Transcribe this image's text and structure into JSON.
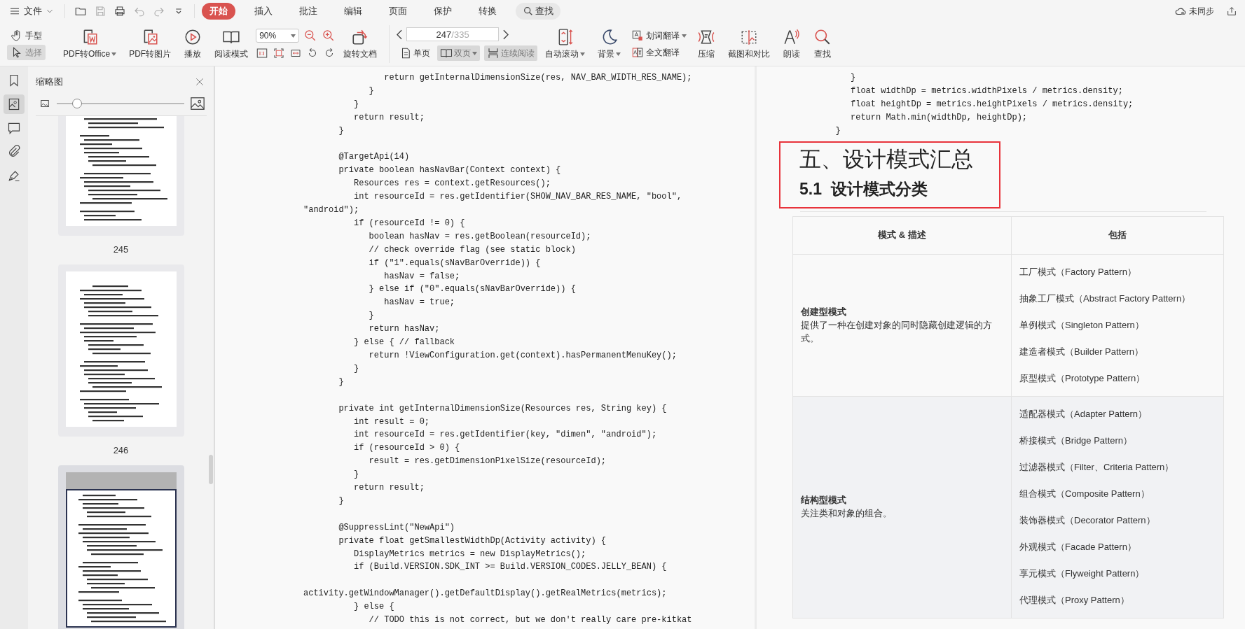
{
  "menu_bar": {
    "file_menu": "文件",
    "tabs": [
      {
        "label": "开始",
        "selected": true
      },
      {
        "label": "插入",
        "selected": false
      },
      {
        "label": "批注",
        "selected": false
      },
      {
        "label": "编辑",
        "selected": false
      },
      {
        "label": "页面",
        "selected": false
      },
      {
        "label": "保护",
        "selected": false
      },
      {
        "label": "转换",
        "selected": false
      }
    ],
    "search": "查找",
    "sync_status": "未同步"
  },
  "toolbar": {
    "tools": [
      {
        "kind": "hand",
        "label": "手型",
        "selected": false
      },
      {
        "kind": "select",
        "label": "选择",
        "selected": true
      }
    ],
    "buttons_a": [
      {
        "kind": "pdf-to-office",
        "label": "PDF转Office",
        "dropdown": true
      },
      {
        "kind": "pdf-to-image",
        "label": "PDF转图片"
      },
      {
        "kind": "play",
        "label": "播放"
      },
      {
        "kind": "reading-mode",
        "label": "阅读模式"
      }
    ],
    "zoom": {
      "value": "90%"
    },
    "rotate": {
      "kind": "rotate-document",
      "label": "旋转文档"
    },
    "page": {
      "current": "247",
      "total": "/335"
    },
    "view_modes": [
      {
        "kind": "single-page",
        "label": "单页",
        "selected": false
      },
      {
        "kind": "double-page",
        "label": "双页",
        "selected": true,
        "dropdown": true
      },
      {
        "kind": "continuous",
        "label": "连续阅读",
        "selected": true
      }
    ],
    "buttons_b": [
      {
        "kind": "auto-scroll",
        "label": "自动滚动",
        "dropdown": true
      },
      {
        "kind": "background",
        "label": "背景",
        "dropdown": true
      }
    ],
    "translate": [
      {
        "kind": "word-translate",
        "label": "划词翻译",
        "dropdown": true
      },
      {
        "kind": "full-translate",
        "label": "全文翻译"
      }
    ],
    "buttons_c": [
      {
        "kind": "compress",
        "label": "压缩"
      },
      {
        "kind": "screenshot-compare",
        "label": "截图和对比"
      },
      {
        "kind": "read-aloud",
        "label": "朗读"
      },
      {
        "kind": "find",
        "label": "查找"
      }
    ]
  },
  "sidebar": {
    "rail": [
      {
        "kind": "bookmark",
        "selected": false
      },
      {
        "kind": "thumbnails",
        "selected": true
      },
      {
        "kind": "comment",
        "selected": false
      },
      {
        "kind": "attachment",
        "selected": false
      },
      {
        "kind": "sign",
        "selected": false
      }
    ],
    "title": "缩略图",
    "zoom_slider": {
      "level": 0.16
    },
    "thumbnails": [
      {
        "label": "245",
        "selected": false
      },
      {
        "label": "246",
        "selected": false
      },
      {
        "selected": true
      }
    ]
  },
  "document": {
    "left_page": {
      "code_blocks": [
        [
          "                return getInternalDimensionSize(res, NAV_BAR_WIDTH_RES_NAME);",
          "             }",
          "          }",
          "          return result;",
          "       }"
        ],
        [
          "       @TargetApi(14)",
          "       private boolean hasNavBar(Context context) {",
          "          Resources res = context.getResources();",
          "          int resourceId = res.getIdentifier(SHOW_NAV_BAR_RES_NAME, \"bool\",",
          "\"android\");",
          "          if (resourceId != 0) {",
          "             boolean hasNav = res.getBoolean(resourceId);",
          "             // check override flag (see static block)",
          "             if (\"1\".equals(sNavBarOverride)) {",
          "                hasNav = false;",
          "             } else if (\"0\".equals(sNavBarOverride)) {",
          "                hasNav = true;",
          "             }",
          "             return hasNav;",
          "          } else { // fallback",
          "             return !ViewConfiguration.get(context).hasPermanentMenuKey();",
          "          }",
          "       }"
        ],
        [
          "       private int getInternalDimensionSize(Resources res, String key) {",
          "          int result = 0;",
          "          int resourceId = res.getIdentifier(key, \"dimen\", \"android\");",
          "          if (resourceId > 0) {",
          "             result = res.getDimensionPixelSize(resourceId);",
          "          }",
          "          return result;",
          "       }"
        ],
        [
          "       @SuppressLint(\"NewApi\")",
          "       private float getSmallestWidthDp(Activity activity) {",
          "          DisplayMetrics metrics = new DisplayMetrics();",
          "          if (Build.VERSION.SDK_INT >= Build.VERSION_CODES.JELLY_BEAN) {"
        ],
        [
          "activity.getWindowManager().getDefaultDisplay().getRealMetrics(metrics);",
          "          } else {",
          "             // TODO this is not correct, but we don't really care pre-kitkat"
        ]
      ]
    },
    "right_page": {
      "code_blocks": [
        [
          "          }",
          "          float widthDp = metrics.widthPixels / metrics.density;",
          "          float heightDp = metrics.heightPixels / metrics.density;",
          "          return Math.min(widthDp, heightDp);",
          "       }"
        ]
      ],
      "heading": "五、设计模式汇总",
      "subheading": "5.1  设计模式分类",
      "table": {
        "columns": [
          "模式 & 描述",
          "包括"
        ],
        "rows": [
          {
            "category": "创建型模式",
            "description": "提供了一种在创建对象的同时隐藏创建逻辑的方式。",
            "patterns": [
              "工厂模式（Factory Pattern）",
              "抽象工厂模式（Abstract Factory Pattern）",
              "单例模式（Singleton Pattern）",
              "建造者模式（Builder Pattern）",
              "原型模式（Prototype Pattern）"
            ]
          },
          {
            "category": "结构型模式",
            "description": "关注类和对象的组合。",
            "patterns": [
              "适配器模式（Adapter Pattern）",
              "桥接模式（Bridge Pattern）",
              "过滤器模式（Filter、Criteria Pattern）",
              "组合模式（Composite Pattern）",
              "装饰器模式（Decorator Pattern）",
              "外观模式（Facade Pattern）",
              "享元模式（Flyweight Pattern）",
              "代理模式（Proxy Pattern）"
            ]
          }
        ]
      }
    }
  }
}
